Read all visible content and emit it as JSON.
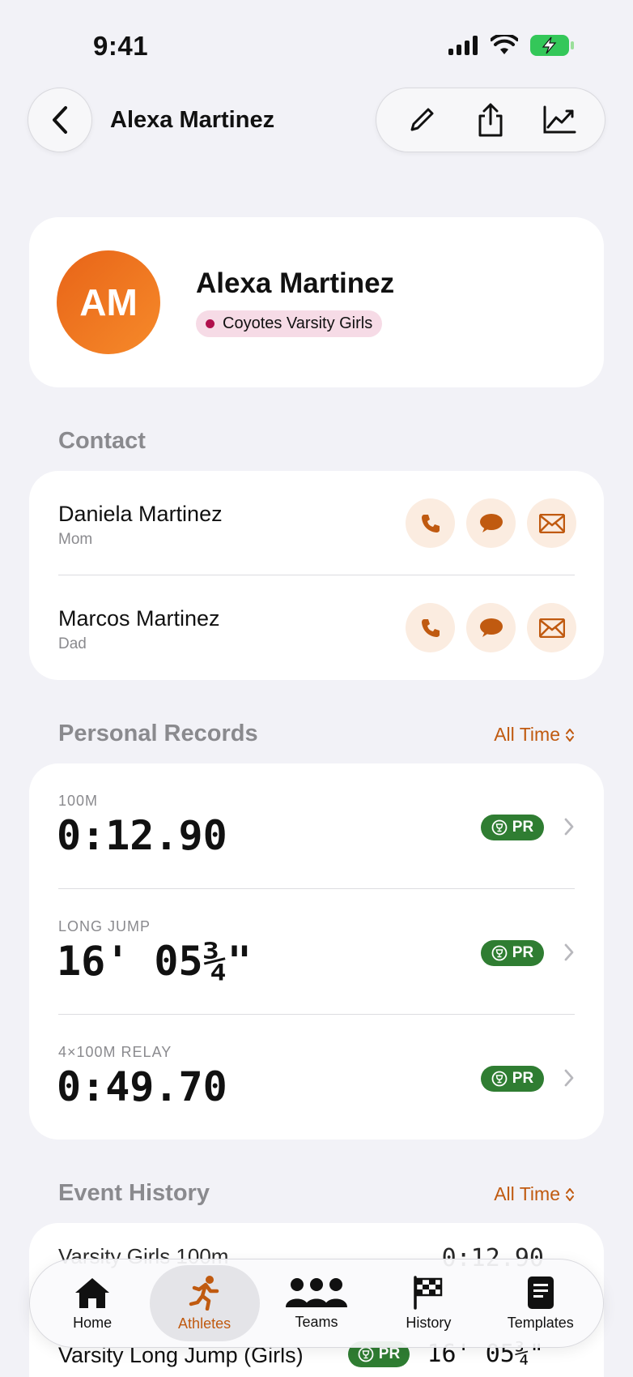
{
  "status_bar": {
    "time": "9:41"
  },
  "nav": {
    "title": "Alexa Martinez"
  },
  "profile": {
    "initials": "AM",
    "name": "Alexa Martinez",
    "team": "Coyotes Varsity Girls"
  },
  "contact": {
    "header": "Contact",
    "items": [
      {
        "name": "Daniela Martinez",
        "relation": "Mom"
      },
      {
        "name": "Marcos Martinez",
        "relation": "Dad"
      }
    ]
  },
  "records": {
    "header": "Personal Records",
    "filter": "All Time",
    "items": [
      {
        "event": "100M",
        "value": "0:12.90",
        "badge": "PR"
      },
      {
        "event": "LONG JUMP",
        "value": "16' 05¾\"",
        "badge": "PR"
      },
      {
        "event": "4×100M RELAY",
        "value": "0:49.70",
        "badge": "PR"
      }
    ]
  },
  "history": {
    "header": "Event History",
    "filter": "All Time",
    "items": [
      {
        "event": "Varsity Girls 100m",
        "value": "0:12.90"
      },
      {
        "event": "Varsity Long Jump (Girls)",
        "value": "16' 05¾\"",
        "badge": "PR"
      }
    ]
  },
  "tabs": [
    {
      "label": "Home",
      "icon": "house-icon"
    },
    {
      "label": "Athletes",
      "icon": "runner-icon"
    },
    {
      "label": "Teams",
      "icon": "people-icon"
    },
    {
      "label": "History",
      "icon": "checkered-flag-icon"
    },
    {
      "label": "Templates",
      "icon": "document-icon"
    }
  ],
  "colors": {
    "accent": "#c05a10",
    "avatar": "#ed6f1c",
    "pr_badge": "#2f7d32",
    "team_dot": "#b0104c",
    "background": "#f2f2f7"
  }
}
